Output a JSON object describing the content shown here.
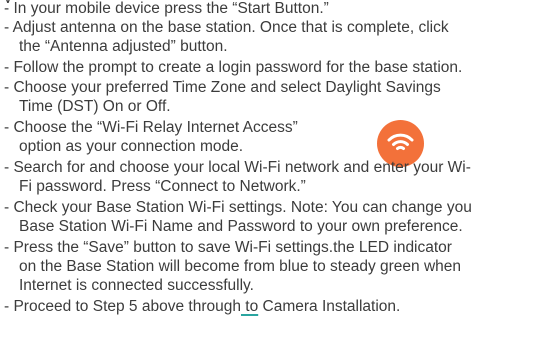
{
  "lines": {
    "l1": "- In your mobile device press the “Start Button.”",
    "l2a": "- Adjust antenna on the base station. Once that is complete, click",
    "l2b": "the “Antenna adjusted” button.",
    "l3": "- Follow the prompt to create a login password for the base station.",
    "l4a": "- Choose your preferred Time Zone and select Daylight Savings",
    "l4b": "Time (DST) On or Off.",
    "l5a": "- Choose the “Wi-Fi Relay Internet Access”",
    "l5b": "option as your connection mode.",
    "l6a": "- Search for and choose your local Wi-Fi network and enter your Wi-",
    "l6b": "Fi password. Press “Connect to Network.”",
    "l7a": "- Check your Base Station Wi-Fi settings. Note: You can change you",
    "l7b": "Base Station Wi-Fi Name and Password to your own preference.",
    "l8a": "- Press the “Save” button to save Wi-Fi settings.the LED indicator",
    "l8b": "on the Base Station will become from blue to steady green when",
    "l8c": "Internet is connected successfully.",
    "l9_pre": "- Proceed to Step 5 above through",
    "l9_link": " to",
    "l9_post": " Camera Installation."
  },
  "icons": {
    "wifi_badge": "wifi-icon",
    "wifi_badge_color": "#f3713a"
  }
}
